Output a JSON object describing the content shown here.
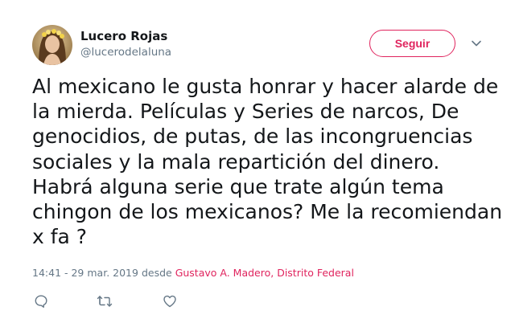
{
  "author": {
    "name": "Lucero Rojas",
    "handle": "@lucerodelaluna"
  },
  "follow_button": {
    "label": "Seguir"
  },
  "tweet": {
    "text": "Al mexicano le gusta honrar y hacer alarde de la mierda. Películas y Series de narcos, De genocidios, de putas, de las incongruencias sociales y la mala repartición del dinero.\nHabrá alguna serie que trate algún tema chingon de los mexicanos? Me la recomiendan x fa ?",
    "timestamp": "14:41 - 29 mar. 2019",
    "location_prefix": "desde",
    "location": "Gustavo A. Madero, Distrito Federal"
  },
  "icons": {
    "menu": "chevron-down-icon",
    "reply": "reply-icon",
    "retweet": "retweet-icon",
    "like": "heart-icon"
  },
  "colors": {
    "accent": "#e0245e",
    "secondary_text": "#657786",
    "primary_text": "#14171a"
  }
}
